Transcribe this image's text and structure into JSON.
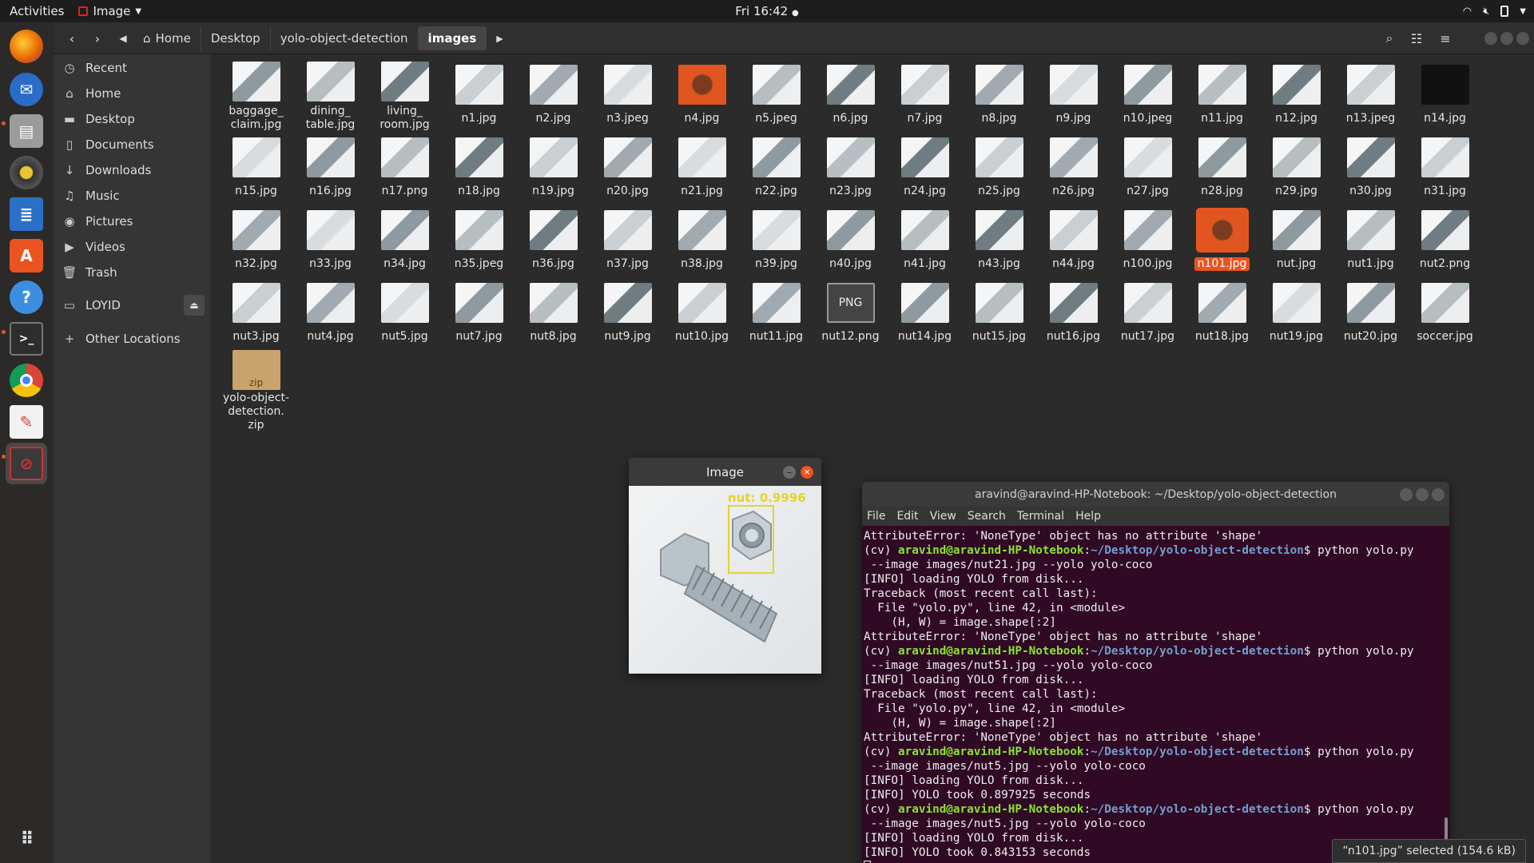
{
  "topbar": {
    "activities": "Activities",
    "app_name": "Image",
    "clock": "Fri 16:42"
  },
  "dock": {
    "items": [
      "firefox-icon",
      "thunderbird-icon",
      "files-icon",
      "rhythmbox-icon",
      "libreoffice-writer-icon",
      "software-center-icon",
      "help-icon",
      "terminal-icon",
      "chrome-icon",
      "text-editor-icon",
      "image-viewer-icon",
      "show-applications-icon"
    ]
  },
  "files": {
    "breadcrumbs": [
      "Home",
      "Desktop",
      "yolo-object-detection",
      "images"
    ],
    "sidebar": [
      {
        "label": "Recent",
        "icon": "clock-icon"
      },
      {
        "label": "Home",
        "icon": "home-icon"
      },
      {
        "label": "Desktop",
        "icon": "folder-icon"
      },
      {
        "label": "Documents",
        "icon": "document-icon"
      },
      {
        "label": "Downloads",
        "icon": "download-icon"
      },
      {
        "label": "Music",
        "icon": "music-icon"
      },
      {
        "label": "Pictures",
        "icon": "camera-icon"
      },
      {
        "label": "Videos",
        "icon": "video-icon"
      },
      {
        "label": "Trash",
        "icon": "trash-icon"
      },
      {
        "label": "LOYID",
        "icon": "drive-icon"
      },
      {
        "label": "Other Locations",
        "icon": "plus-icon"
      }
    ],
    "items": [
      "baggage_\nclaim.jpg",
      "dining_\ntable.jpg",
      "living_\nroom.jpg",
      "n1.jpg",
      "n2.jpg",
      "n3.jpeg",
      "n4.jpg",
      "n5.jpeg",
      "n6.jpg",
      "n7.jpg",
      "n8.jpg",
      "n9.jpg",
      "n10.jpeg",
      "n11.jpg",
      "n12.jpg",
      "n13.jpeg",
      "n14.jpg",
      "n15.jpg",
      "n16.jpg",
      "n17.png",
      "n18.jpg",
      "n19.jpg",
      "n20.jpg",
      "n21.jpg",
      "n22.jpg",
      "n23.jpg",
      "n24.jpg",
      "n25.jpg",
      "n26.jpg",
      "n27.jpg",
      "n28.jpg",
      "n29.jpg",
      "n30.jpg",
      "n31.jpg",
      "n32.jpg",
      "n33.jpg",
      "n34.jpg",
      "n35.jpeg",
      "n36.jpg",
      "n37.jpg",
      "n38.jpg",
      "n39.jpg",
      "n40.jpg",
      "n41.jpg",
      "n43.jpg",
      "n44.jpg",
      "n100.jpg",
      "n101.jpg",
      "nut.jpg",
      "nut1.jpg",
      "nut2.png",
      "nut3.jpg",
      "nut4.jpg",
      "nut5.jpg",
      "nut7.jpg",
      "nut8.jpg",
      "nut9.jpg",
      "nut10.jpg",
      "nut11.jpg",
      "nut12.png",
      "nut14.jpg",
      "nut15.jpg",
      "nut16.jpg",
      "nut17.jpg",
      "nut18.jpg",
      "nut19.jpg",
      "nut20.jpg",
      "soccer.jpg",
      "yolo-object-\ndetection.\nzip"
    ],
    "selected_item": "n101.jpg",
    "png_badge": "PNG",
    "zip_badge": "zip",
    "status": "“n101.jpg” selected  (154.6 kB)"
  },
  "image_window": {
    "title": "Image",
    "detection_label": "nut: 0.9996"
  },
  "terminal": {
    "title": "aravind@aravind-HP-Notebook: ~/Desktop/yolo-object-detection",
    "menu": [
      "File",
      "Edit",
      "View",
      "Search",
      "Terminal",
      "Help"
    ],
    "user": "aravind@aravind-HP-Notebook",
    "path": "~/Desktop/yolo-object-detection",
    "lines": [
      {
        "t": "AttributeError: 'NoneType' object has no attribute 'shape'"
      },
      {
        "p": true,
        "cmd": "python yolo.py"
      },
      {
        "t": " --image images/nut21.jpg --yolo yolo-coco"
      },
      {
        "t": "[INFO] loading YOLO from disk..."
      },
      {
        "t": "Traceback (most recent call last):"
      },
      {
        "t": "  File \"yolo.py\", line 42, in <module>"
      },
      {
        "t": "    (H, W) = image.shape[:2]"
      },
      {
        "t": "AttributeError: 'NoneType' object has no attribute 'shape'"
      },
      {
        "p": true,
        "cmd": "python yolo.py"
      },
      {
        "t": " --image images/nut51.jpg --yolo yolo-coco"
      },
      {
        "t": "[INFO] loading YOLO from disk..."
      },
      {
        "t": "Traceback (most recent call last):"
      },
      {
        "t": "  File \"yolo.py\", line 42, in <module>"
      },
      {
        "t": "    (H, W) = image.shape[:2]"
      },
      {
        "t": "AttributeError: 'NoneType' object has no attribute 'shape'"
      },
      {
        "p": true,
        "cmd": "python yolo.py"
      },
      {
        "t": " --image images/nut5.jpg --yolo yolo-coco"
      },
      {
        "t": "[INFO] loading YOLO from disk..."
      },
      {
        "t": "[INFO] YOLO took 0.897925 seconds"
      },
      {
        "p": true,
        "cmd": "python yolo.py"
      },
      {
        "t": " --image images/nut5.jpg --yolo yolo-coco"
      },
      {
        "t": "[INFO] loading YOLO from disk..."
      },
      {
        "t": "[INFO] YOLO took 0.843153 seconds"
      }
    ]
  },
  "colors": {
    "accent": "#e95420",
    "terminal_bg": "#300a24",
    "prompt_user": "#8ae234",
    "prompt_path": "#729fcf",
    "detection_box": "#e5d22c"
  }
}
